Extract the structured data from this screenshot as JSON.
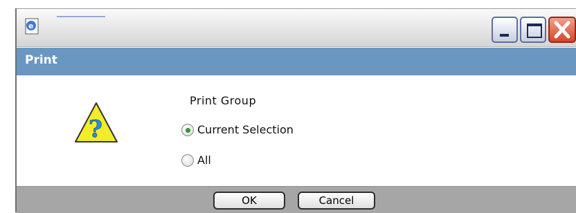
{
  "window": {
    "dialog_title": "Print",
    "controls": [
      "minimize-icon",
      "maximize-icon",
      "close-icon"
    ]
  },
  "content": {
    "group_label": "Print Group",
    "options": [
      {
        "label": "Current Selection",
        "selected": true
      },
      {
        "label": "All",
        "selected": false
      }
    ],
    "icon": "warning-question-icon"
  },
  "buttons": {
    "ok": "OK",
    "cancel": "Cancel"
  },
  "colors": {
    "header_band": "#6a97c2",
    "footer": "#a6a6a6",
    "radio_selected": "#2f9a2f",
    "warning_fill": "#f4ec2a"
  }
}
